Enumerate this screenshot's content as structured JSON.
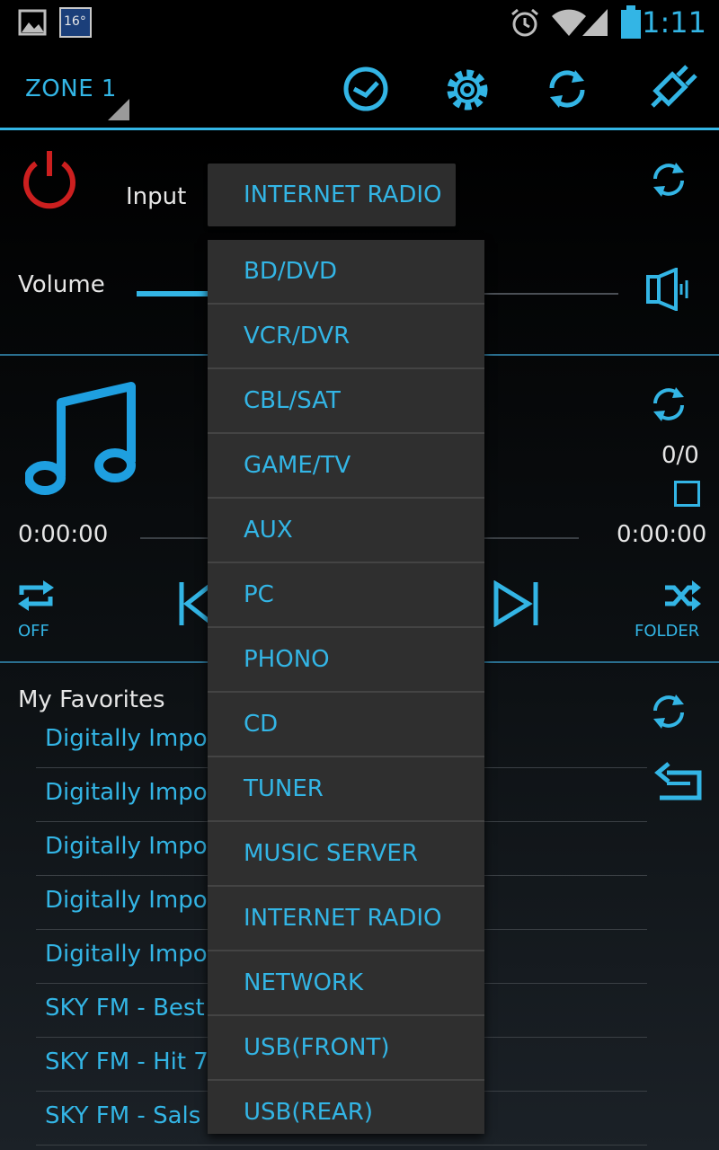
{
  "status_bar": {
    "time": "1:11",
    "weather_badge": "16°",
    "icons": [
      "image-icon",
      "weather-icon",
      "alarm-icon",
      "wifi-icon",
      "signal-icon",
      "battery-icon"
    ]
  },
  "action_bar": {
    "zone": "ZONE 1",
    "actions": [
      "sleep-timer-icon",
      "settings-gear-icon",
      "refresh-icon",
      "connect-plug-icon"
    ]
  },
  "controls": {
    "input_label": "Input",
    "input_value": "INTERNET RADIO",
    "volume_label": "Volume",
    "volume_level": 0.28
  },
  "player": {
    "track_count": "0/0",
    "elapsed": "0:00:00",
    "total": "0:00:00",
    "repeat_label": "OFF",
    "shuffle_label": "FOLDER"
  },
  "favorites": {
    "title": "My Favorites",
    "items": [
      "Digitally Impor",
      "Digitally Impor",
      "Digitally Impor",
      "Digitally Impor",
      "Digitally Impor",
      "SKY FM - Best",
      "SKY FM - Hit 7",
      "SKY FM - Sals"
    ]
  },
  "dropdown": {
    "options": [
      "BD/DVD",
      "VCR/DVR",
      "CBL/SAT",
      "GAME/TV",
      "AUX",
      "PC",
      "PHONO",
      "CD",
      "TUNER",
      "MUSIC SERVER",
      "INTERNET RADIO",
      "NETWORK",
      "USB(FRONT)",
      "USB(REAR)"
    ]
  },
  "colors": {
    "accent": "#33b5e5",
    "power": "#cc1f1f",
    "background": "#000000",
    "dropdown_bg": "#2f2f2f"
  }
}
